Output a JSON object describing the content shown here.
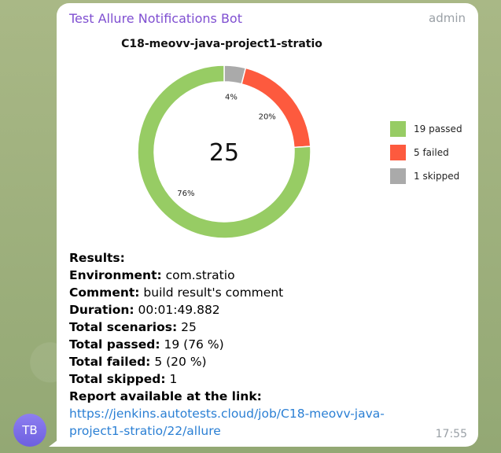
{
  "message": {
    "sender": "Test Allure Notifications Bot",
    "role": "admin",
    "time": "17:55",
    "avatar_initials": "TB"
  },
  "chart_data": {
    "type": "pie",
    "title": "C18-meovv-java-project1-stratio",
    "center_label": "25",
    "slices": [
      {
        "name": "passed",
        "value": 19,
        "percent_label": "76%",
        "color": "#97cc64"
      },
      {
        "name": "failed",
        "value": 5,
        "percent_label": "20%",
        "color": "#fd5a3e"
      },
      {
        "name": "skipped",
        "value": 1,
        "percent_label": "4%",
        "color": "#aaaaaa"
      }
    ],
    "legend": [
      "19 passed",
      "5 failed",
      "1 skipped"
    ],
    "legend_position": "right"
  },
  "results": {
    "heading": "Results:",
    "environment_label": "Environment:",
    "environment": "com.stratio",
    "comment_label": "Comment:",
    "comment": "build result's comment",
    "duration_label": "Duration:",
    "duration": "00:01:49.882",
    "scenarios_label": "Total scenarios:",
    "scenarios": "25",
    "passed_label": "Total passed:",
    "passed": "19 (76 %)",
    "failed_label": "Total failed:",
    "failed": "5 (20 %)",
    "skipped_label": "Total skipped:",
    "skipped": "1",
    "report_label": "Report available at the link:",
    "report_link": "https://jenkins.autotests.cloud/job/C18-meovv-java-project1-stratio/22/allure"
  }
}
